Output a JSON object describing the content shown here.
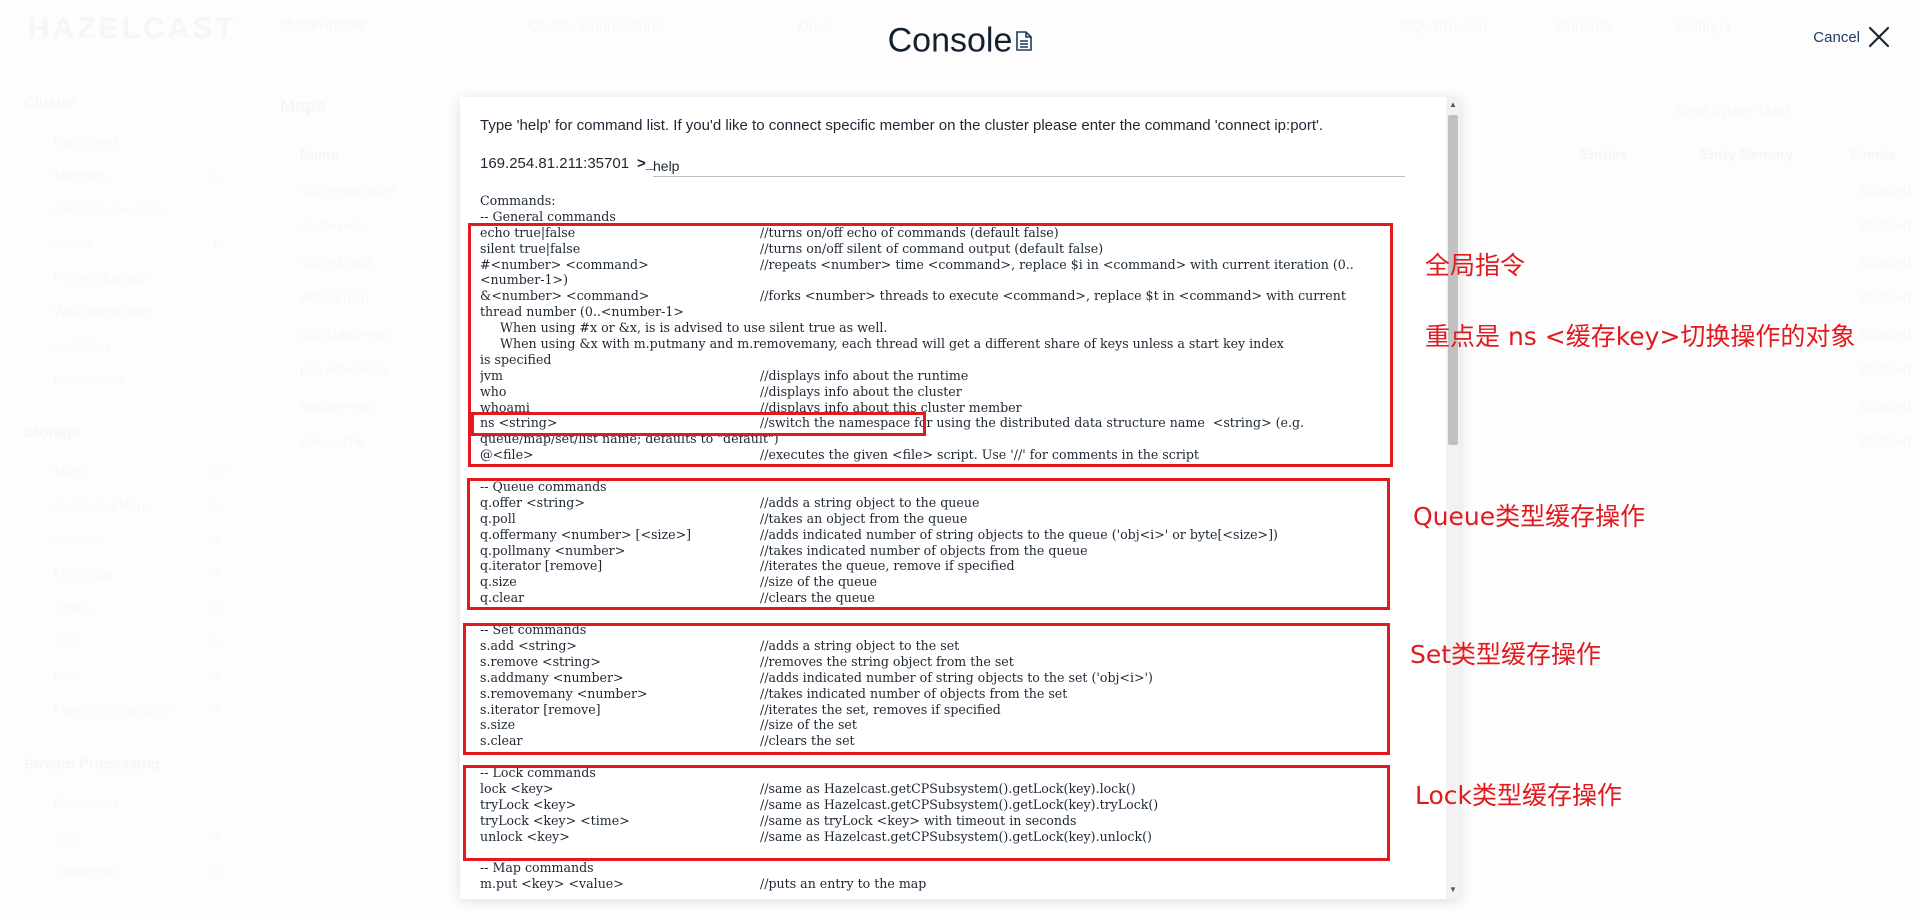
{
  "background": {
    "logo": "HAZELCAST",
    "cluster_selector": "cluster-name",
    "top_nav": [
      "Cluster Connections",
      "Docs",
      "SQL Browser",
      "Console",
      "Settings",
      "Notifications"
    ],
    "sidebar": [
      {
        "label": "Cluster",
        "items": [
          {
            "label": "Dashboard",
            "count": ""
          },
          {
            "label": "Members",
            "count": "1"
          },
          {
            "label": "Client Connections",
            "count": ""
          },
          {
            "label": "Clients",
            "count": "1"
          },
          {
            "label": "Rolling Upgrade",
            "count": ""
          },
          {
            "label": "WAN Replication",
            "count": ""
          },
          {
            "label": "Licensing",
            "count": ""
          },
          {
            "label": "Healthcheck",
            "count": ""
          }
        ]
      },
      {
        "label": "Storage",
        "items": [
          {
            "label": "Maps",
            "count": "10"
          },
          {
            "label": "Replicated Maps",
            "count": "0"
          },
          {
            "label": "Caches",
            "count": "0"
          },
          {
            "label": "MultiMaps",
            "count": "0"
          },
          {
            "label": "Topics",
            "count": "0"
          },
          {
            "label": "Sets",
            "count": "0"
          },
          {
            "label": "Lists",
            "count": "0"
          },
          {
            "label": "Flake ID Generators",
            "count": "0"
          }
        ]
      },
      {
        "label": "Stream Processing",
        "items": [
          {
            "label": "Dashboard",
            "count": ""
          },
          {
            "label": "Jobs",
            "count": "0"
          },
          {
            "label": "Connectors",
            "count": "0"
          }
        ]
      }
    ],
    "main_title": "Maps",
    "table_headers": [
      "Name",
      "Entries",
      "Entry Memory",
      "Events"
    ],
    "rows": [
      "cache-expiration",
      "cache-map",
      "cached-data",
      "default-map",
      "distributed-map",
      "properties-map",
      "session-map",
      "user-cache"
    ],
    "row_status": "Disabled",
    "system_maps_toggle": "Show System Maps"
  },
  "modal": {
    "title": "Console",
    "title_icon": "document-icon",
    "cancel_label": "Cancel"
  },
  "console": {
    "intro": "Type 'help' for command list. If you'd like to connect specific member on the cluster please enter the command 'connect ip:port'.",
    "prompt_address": "169.254.81.211:35701",
    "prompt_symbol": ">_",
    "input_value": "help",
    "lines": [
      {
        "c": "Commands:",
        "d": ""
      },
      {
        "c": "-- General commands",
        "d": ""
      },
      {
        "c": "echo true|false",
        "d": "//turns on/off echo of commands (default false)"
      },
      {
        "c": "silent true|false",
        "d": "//turns on/off silent of command output (default false)"
      },
      {
        "c": "#<number> <command>",
        "d": "//repeats <number> time <command>, replace $i in <command> with current iteration (0.."
      },
      {
        "c": "<number-1>)",
        "d": ""
      },
      {
        "c": "&<number> <command>",
        "d": "//forks <number> threads to execute <command>, replace $t in <command> with current"
      },
      {
        "c": "thread number (0..<number-1>",
        "d": ""
      },
      {
        "c": "     When using #x or &x, is is advised to use silent true as well.",
        "d": ""
      },
      {
        "c": "     When using &x with m.putmany and m.removemany, each thread will get a different share of keys unless a start key index",
        "d": ""
      },
      {
        "c": "is specified",
        "d": ""
      },
      {
        "c": "jvm",
        "d": "//displays info about the runtime"
      },
      {
        "c": "who",
        "d": "//displays info about the cluster"
      },
      {
        "c": "whoami",
        "d": "//displays info about this cluster member"
      },
      {
        "c": "ns <string>",
        "d": "//switch the namespace for using the distributed data structure name  <string> (e.g."
      },
      {
        "c": "queue/map/set/list name; defaults to \"default\")",
        "d": ""
      },
      {
        "c": "@<file>",
        "d": "//executes the given <file> script. Use '//' for comments in the script"
      },
      {
        "c": "",
        "d": ""
      },
      {
        "c": "-- Queue commands",
        "d": ""
      },
      {
        "c": "q.offer <string>",
        "d": "//adds a string object to the queue"
      },
      {
        "c": "q.poll",
        "d": "//takes an object from the queue"
      },
      {
        "c": "q.offermany <number> [<size>]",
        "d": "//adds indicated number of string objects to the queue ('obj<i>' or byte[<size>])"
      },
      {
        "c": "q.pollmany <number>",
        "d": "//takes indicated number of objects from the queue"
      },
      {
        "c": "q.iterator [remove]",
        "d": "//iterates the queue, remove if specified"
      },
      {
        "c": "q.size",
        "d": "//size of the queue"
      },
      {
        "c": "q.clear",
        "d": "//clears the queue"
      },
      {
        "c": "",
        "d": ""
      },
      {
        "c": "-- Set commands",
        "d": ""
      },
      {
        "c": "s.add <string>",
        "d": "//adds a string object to the set"
      },
      {
        "c": "s.remove <string>",
        "d": "//removes the string object from the set"
      },
      {
        "c": "s.addmany <number>",
        "d": "//adds indicated number of string objects to the set ('obj<i>')"
      },
      {
        "c": "s.removemany <number>",
        "d": "//takes indicated number of objects from the set"
      },
      {
        "c": "s.iterator [remove]",
        "d": "//iterates the set, removes if specified"
      },
      {
        "c": "s.size",
        "d": "//size of the set"
      },
      {
        "c": "s.clear",
        "d": "//clears the set"
      },
      {
        "c": "",
        "d": ""
      },
      {
        "c": "-- Lock commands",
        "d": ""
      },
      {
        "c": "lock <key>",
        "d": "//same as Hazelcast.getCPSubsystem().getLock(key).lock()"
      },
      {
        "c": "tryLock <key>",
        "d": "//same as Hazelcast.getCPSubsystem().getLock(key).tryLock()"
      },
      {
        "c": "tryLock <key> <time>",
        "d": "//same as tryLock <key> with timeout in seconds"
      },
      {
        "c": "unlock <key>",
        "d": "//same as Hazelcast.getCPSubsystem().getLock(key).unlock()"
      },
      {
        "c": "",
        "d": ""
      },
      {
        "c": "-- Map commands",
        "d": ""
      },
      {
        "c": "m.put <key> <value>",
        "d": "//puts an entry to the map"
      }
    ]
  },
  "annotations": {
    "general_label": "全局指令",
    "ns_label": "重点是 ns <缓存key>切换操作的对象",
    "queue_label": "Queue类型缓存操作",
    "set_label": "Set类型缓存操作",
    "lock_label": "Lock类型缓存操作",
    "color": "#e2191d"
  }
}
